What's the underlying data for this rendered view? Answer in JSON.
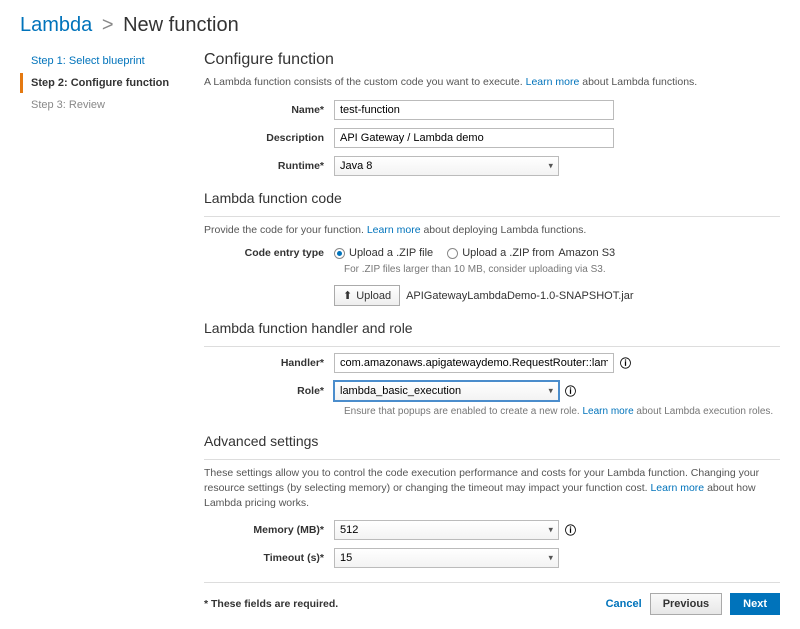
{
  "breadcrumb": {
    "root": "Lambda",
    "sep": ">",
    "current": "New function"
  },
  "sidebar": {
    "steps": [
      {
        "label": "Step 1: Select blueprint"
      },
      {
        "label": "Step 2: Configure function"
      },
      {
        "label": "Step 3: Review"
      }
    ]
  },
  "section_configure": {
    "title": "Configure function",
    "desc_pre": "A Lambda function consists of the custom code you want to execute. ",
    "learn_more": "Learn more",
    "desc_post": " about Lambda functions.",
    "name_label": "Name*",
    "name_value": "test-function",
    "desc_label": "Description",
    "desc_value": "API Gateway / Lambda demo",
    "runtime_label": "Runtime*",
    "runtime_value": "Java 8"
  },
  "section_code": {
    "title": "Lambda function code",
    "desc_pre": "Provide the code for your function. ",
    "learn_more": "Learn more",
    "desc_post": " about deploying Lambda functions.",
    "entry_label": "Code entry type",
    "opt_upload": "Upload a .ZIP file",
    "opt_s3_pre": "Upload a .ZIP from ",
    "opt_s3_link": "Amazon S3",
    "hint": "For .ZIP files larger than 10 MB, consider uploading via S3.",
    "upload_btn": "Upload",
    "filename": "APIGatewayLambdaDemo-1.0-SNAPSHOT.jar"
  },
  "section_handler": {
    "title": "Lambda function handler and role",
    "handler_label": "Handler*",
    "handler_value": "com.amazonaws.apigatewaydemo.RequestRouter::lambdaH",
    "role_label": "Role*",
    "role_value": "lambda_basic_execution",
    "role_hint_pre": "Ensure that popups are enabled to create a new role. ",
    "learn_more": "Learn more",
    "role_hint_post": " about Lambda execution roles."
  },
  "section_advanced": {
    "title": "Advanced settings",
    "desc_pre": "These settings allow you to control the code execution performance and costs for your Lambda function. Changing your resource settings (by selecting memory) or changing the timeout may impact your function cost. ",
    "learn_more": "Learn more",
    "desc_post": " about how Lambda pricing works.",
    "memory_label": "Memory (MB)*",
    "memory_value": "512",
    "timeout_label": "Timeout (s)*",
    "timeout_value": "15"
  },
  "footer": {
    "required_note": "* These fields are required.",
    "cancel": "Cancel",
    "previous": "Previous",
    "next": "Next"
  }
}
